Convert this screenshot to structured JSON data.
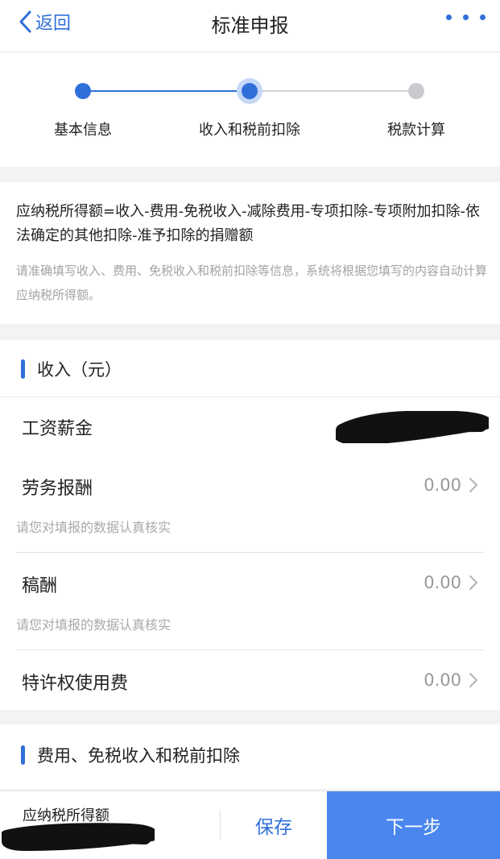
{
  "header": {
    "back_label": "返回",
    "title": "标准申报"
  },
  "steps": [
    {
      "label": "基本信息",
      "state": "done"
    },
    {
      "label": "收入和税前扣除",
      "state": "current"
    },
    {
      "label": "税款计算",
      "state": "pending"
    }
  ],
  "formula": {
    "main": "应纳税所得额=收入-费用-免税收入-减除费用-专项扣除-专项附加扣除-依法确定的其他扣除-准予扣除的捐赠额",
    "hint": "请准确填写收入、费用、免税收入和税前扣除等信息，系统将根据您填写的内容自动计算应纳税所得额。"
  },
  "income": {
    "title": "收入（元）",
    "rows": [
      {
        "label": "工资薪金"
      },
      {
        "label": "劳务报酬",
        "value": "0.00",
        "hint": "请您对填报的数据认真核实"
      },
      {
        "label": "稿酬",
        "value": "0.00",
        "hint": "请您对填报的数据认真核实"
      },
      {
        "label": "特许权使用费",
        "value": "0.00"
      }
    ]
  },
  "deductions": {
    "title": "费用、免税收入和税前扣除"
  },
  "footer": {
    "taxable_label": "应纳税所得额",
    "save_label": "保存",
    "next_label": "下一步"
  },
  "colors": {
    "accent": "#2f6fd9",
    "primary_button": "#4a86ee",
    "pending_dot": "#c9c9d0"
  },
  "icons": [
    "back-chevron-icon",
    "more-dots-icon",
    "chevron-right-icon"
  ]
}
